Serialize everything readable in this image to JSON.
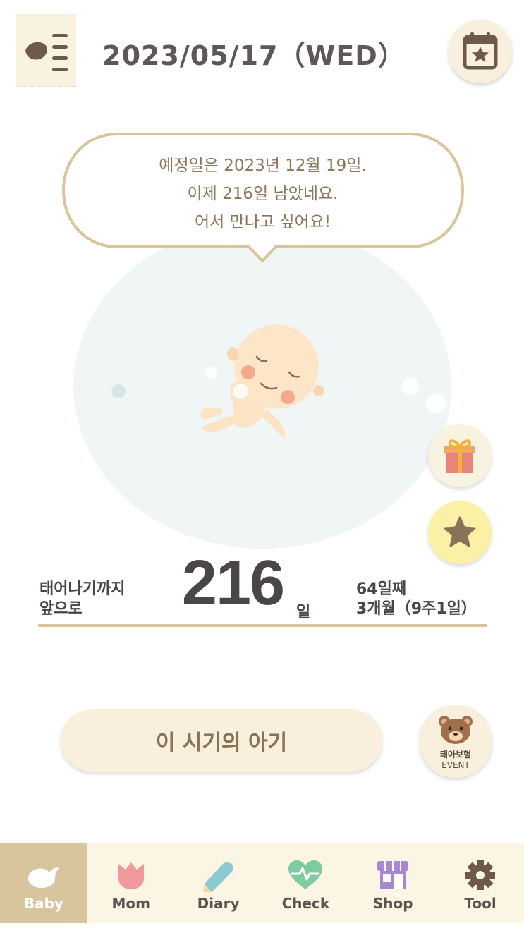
{
  "header": {
    "date": "2023/05/17（WED）",
    "menu_icon": "bird-list-icon",
    "calendar_icon": "calendar-star-icon"
  },
  "bubble": {
    "line1": "예정일은 2023년 12월 19일.",
    "line2": "이제 216일 남았네요.",
    "line3": "어서 만나고 싶어요!"
  },
  "counter": {
    "left_label_line1": "태어나기까지",
    "left_label_line2": "앞으로",
    "days_left": "216",
    "unit": "일",
    "day_count": "64일째",
    "month_week": "3개월（9주1일）"
  },
  "side_buttons": {
    "gift_icon": "gift-icon",
    "star_icon": "star-icon"
  },
  "main_button": {
    "label": "이 시기의 아기"
  },
  "event": {
    "line1": "태아보험",
    "line2": "EVENT",
    "icon": "bear-icon"
  },
  "tabs": [
    {
      "label": "Baby",
      "icon": "bird-icon",
      "active": true
    },
    {
      "label": "Mom",
      "icon": "tulip-icon",
      "active": false
    },
    {
      "label": "Diary",
      "icon": "pencil-icon",
      "active": false
    },
    {
      "label": "Check",
      "icon": "heart-pulse-icon",
      "active": false
    },
    {
      "label": "Shop",
      "icon": "store-icon",
      "active": false
    },
    {
      "label": "Tool",
      "icon": "gear-icon",
      "active": false
    }
  ],
  "colors": {
    "accent_gold": "#d8c49b",
    "bubble_text": "#8d755a",
    "tab_bg": "#fbf5e4",
    "active_tab": "#d8c49d",
    "star_bg": "#fbf1a6"
  }
}
